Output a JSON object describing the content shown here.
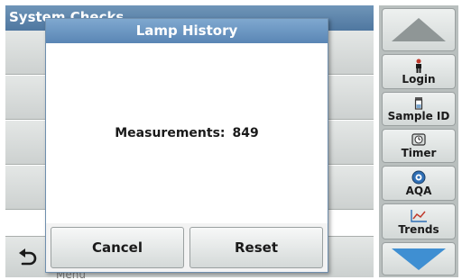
{
  "background": {
    "header_title": "System Checks",
    "row_fragment": "e",
    "menu_label": "Menu"
  },
  "sidebar": {
    "tools": [
      {
        "label": "Login",
        "icon": "person-icon"
      },
      {
        "label": "Sample ID",
        "icon": "sample-vial-icon"
      },
      {
        "label": "Timer",
        "icon": "timer-icon"
      },
      {
        "label": "AQA",
        "icon": "aqa-icon"
      },
      {
        "label": "Trends",
        "icon": "trend-chart-icon"
      }
    ]
  },
  "dialog": {
    "title": "Lamp History",
    "measurements_label": "Measurements:",
    "measurements_value": "849",
    "cancel_label": "Cancel",
    "reset_label": "Reset"
  },
  "colors": {
    "title_bar": "#5a86b5",
    "arrow_blue": "#3f8fd2",
    "arrow_gray": "#8f9696"
  }
}
